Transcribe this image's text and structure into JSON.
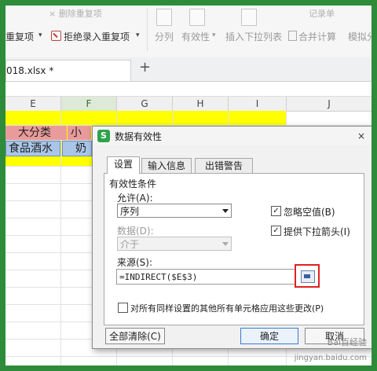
{
  "ribbon": {
    "faded_items": [
      "× 删除重复项",
      "记录单"
    ],
    "repeat_item": "重复项",
    "reject_item": "拒绝录入重复项",
    "split": "分列",
    "validity": "有效性",
    "insert_dropdown": "插入下拉列表",
    "merge_calc": "合并计算",
    "simulate": "模拟分"
  },
  "file_tab": {
    "name": "018.xlsx *",
    "add": "+"
  },
  "sheet": {
    "columns": [
      "E",
      "F",
      "G",
      "H",
      "I",
      "J"
    ],
    "header_cell_1": "大分类",
    "header_cell_2": "小",
    "value_cell_1": "食品酒水",
    "value_cell_2": "奶"
  },
  "dialog": {
    "title": "数据有效性",
    "app_icon": "S",
    "close": "×",
    "tabs": [
      "设置",
      "输入信息",
      "出错警告"
    ],
    "section": "有效性条件",
    "allow_label": "允许(A):",
    "allow_value": "序列",
    "data_label": "数据(D):",
    "data_value": "介于",
    "ignore_blank": "忽略空值(B)",
    "dropdown_arrow": "提供下拉箭头(I)",
    "source_label": "来源(S):",
    "source_value": "=INDIRECT($E$3)",
    "apply_all": "对所有同样设置的其他所有单元格应用这些更改(P)",
    "clear_all": "全部清除(C)",
    "ok": "确定",
    "cancel": "取消"
  },
  "watermark": {
    "brand": "Bai百经验",
    "url": "jingyan.baidu.com"
  },
  "colors": {
    "frame": "#2e8b3a",
    "header_fill": "#ffff00",
    "accent_red": "#e02020"
  }
}
